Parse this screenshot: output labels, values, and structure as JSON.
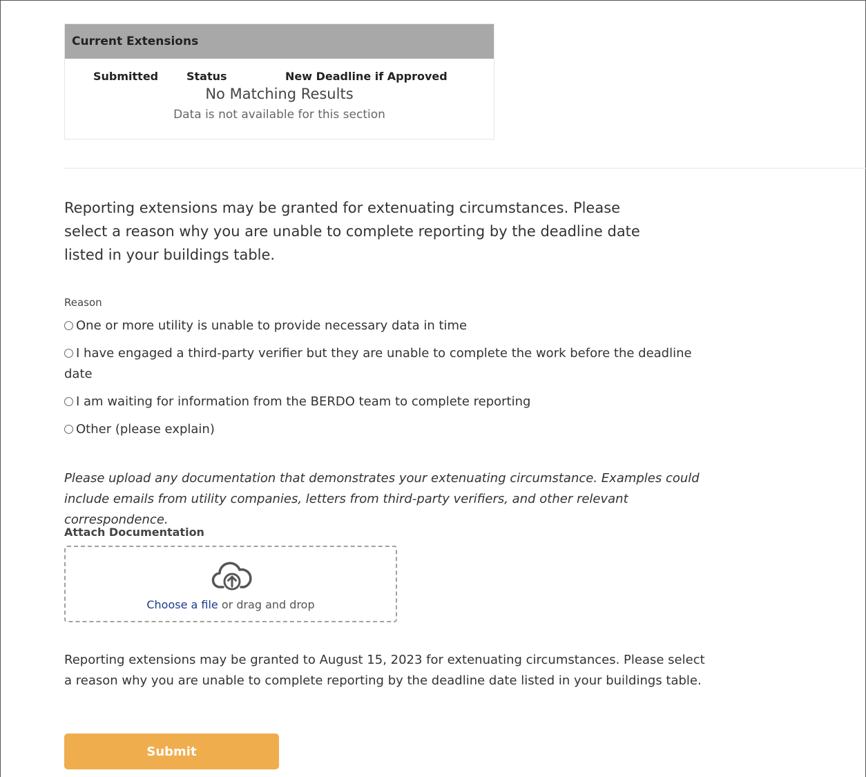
{
  "extensions": {
    "title": "Current Extensions",
    "columns": [
      "Submitted",
      "Status",
      "New Deadline if Approved"
    ],
    "empty_title": "No Matching Results",
    "empty_subtitle": "Data is not available for this section"
  },
  "intro_text": "Reporting extensions may be granted for extenuating circumstances. Please select a reason why you are unable to complete reporting by the deadline date listed in your buildings table.",
  "reason": {
    "label": "Reason",
    "options": [
      "One or more utility is unable to provide necessary data in time",
      "I have engaged a third-party verifier but they are unable to complete the work before the deadline date",
      "I am waiting for information from the BERDO team to complete reporting",
      "Other (please explain)"
    ]
  },
  "upload_note": "Please upload any documentation that demonstrates your extenuating circumstance. Examples could include emails from utility companies, letters from third-party verifiers, and other relevant correspondence.",
  "attach": {
    "label": "Attach Documentation",
    "choose_link": "Choose a file",
    "drop_text": " or drag and drop",
    "icon": "cloud-upload-icon"
  },
  "final_note": "Reporting extensions may be granted to August 15, 2023 for extenuating circumstances. Please select a reason why you are unable to complete reporting by the deadline date listed in your buildings table.",
  "submit_label": "Submit",
  "colors": {
    "header_bg": "#a8a8a8",
    "submit_bg": "#f0ad4e",
    "link": "#1a3a8c"
  }
}
